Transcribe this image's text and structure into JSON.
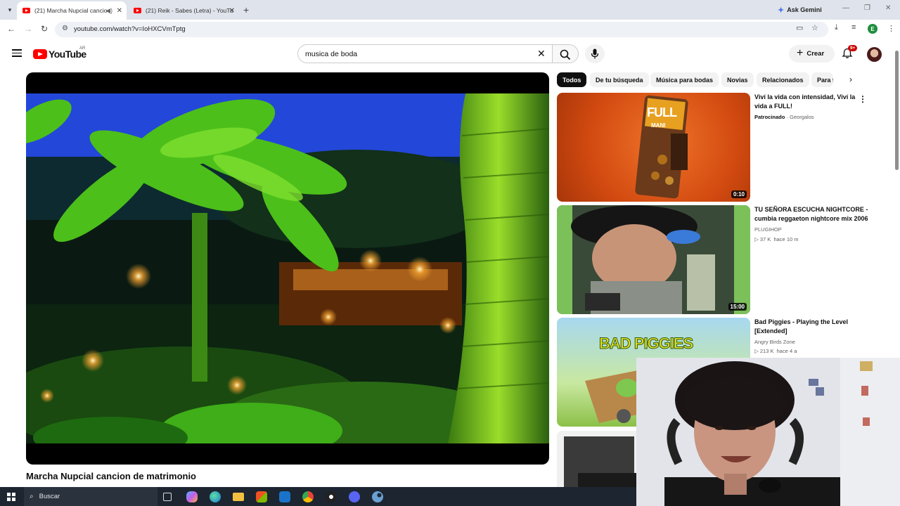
{
  "browser": {
    "tabs": [
      {
        "title": "(21) Marcha Nupcial cancio",
        "active": true
      },
      {
        "title": "(21) Reik - Sabes (Letra) - YouTu",
        "active": false
      }
    ],
    "gemini_label": "Ask Gemini",
    "url": "youtube.com/watch?v=IoHXCVmTptg",
    "profile_initial": "E"
  },
  "youtube": {
    "logo_text": "YouTube",
    "region": "AR",
    "search_value": "musica de boda",
    "create_label": "Crear",
    "notification_count": "9+",
    "video_title": "Marcha Nupcial cancion de matrimonio",
    "chips": [
      "Todos",
      "De tu búsqueda",
      "Música para bodas",
      "Novias",
      "Relacionados",
      "Para ti"
    ],
    "related": [
      {
        "title": "Viví la vida con intensidad, Viví la vida a FULL!",
        "sponsored": "Patrocinado",
        "channel": "Georgalos",
        "duration": "0:10"
      },
      {
        "title": "TU SEÑORA ESCUCHA NIGHTCORE - cumbia reggaeton nightcore mix 2006",
        "channel": "PLUGIHOP",
        "views": "37 K",
        "age": "hace 10 m",
        "duration": "15:00"
      },
      {
        "title": "Bad Piggies - Playing the Level [Extended]",
        "channel": "Angry Birds Zone",
        "views": "213 K",
        "age": "hace 4 a",
        "thumb_text": "BAD PIGGIES"
      }
    ],
    "thumb1_text": "FULL",
    "thumb1_subtext": "MANI"
  },
  "taskbar": {
    "search_placeholder": "Buscar"
  },
  "colors": {
    "youtube_red": "#ff0000",
    "chip_active": "#0f0f0f",
    "taskbar_bg": "#1c2530"
  }
}
